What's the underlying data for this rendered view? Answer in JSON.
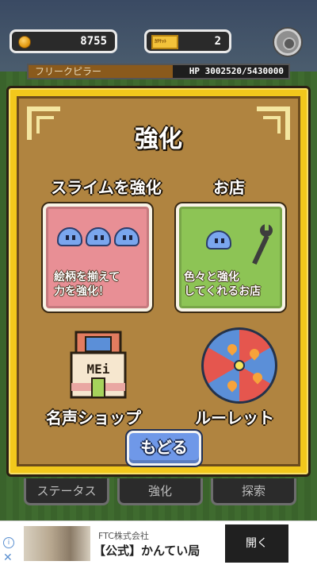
{
  "hud": {
    "coins": "8755",
    "ticket_label": "ｶﾁｹｯﾄ",
    "tickets": "2"
  },
  "enemy": {
    "name": "フリークピラー",
    "hp": "HP 3002520/5430000"
  },
  "panel": {
    "title": "強化",
    "slime_section": "スライムを強化",
    "shop_section": "お店",
    "slime_card_text": "絵柄を揃えて\n力を強化！",
    "shop_card_text": "色々と強化\nしてくれるお店",
    "mei_sign": "MEi",
    "fame_shop_label": "名声ショップ",
    "roulette_label": "ルーレット",
    "back_label": "もどる"
  },
  "bottom_tabs": [
    "ステータス",
    "強化",
    "探索"
  ],
  "ad": {
    "sponsor": "FTC株式会社",
    "title": "【公式】かんてい局",
    "cta": "開く"
  },
  "colors": {
    "panel_frame": "#f2c81c",
    "panel_fill": "#b08440",
    "slime_card": "#e88f95",
    "shop_card": "#8dc455",
    "back_button": "#6f98e8"
  }
}
